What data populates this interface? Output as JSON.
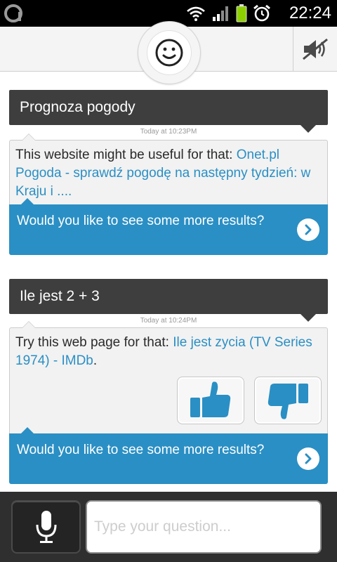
{
  "status_bar": {
    "time": "22:24",
    "icons": [
      "app-logo-icon",
      "wifi-icon",
      "signal-icon",
      "battery-icon",
      "alarm-icon"
    ]
  },
  "top_bar": {
    "avatar_icon": "smiley-face-icon",
    "mute_icon": "speaker-muted-icon"
  },
  "conversation": [
    {
      "query": "Prognoza pogody",
      "timestamp": "Today at 10:23PM",
      "answer_prefix": "This website might be useful for that: ",
      "answer_link": "Onet.pl Pogoda - sprawdź pogodę na następny tydzień: w Kraju i ....",
      "more_results": "Would you like to see some more results?"
    },
    {
      "query": "Ile jest 2 + 3",
      "timestamp": "Today at 10:24PM",
      "answer_prefix": "Try this web page for that: ",
      "answer_link": "Ile jest zycia (TV Series 1974) - IMDb",
      "answer_suffix": ".",
      "feedback_icons": [
        "thumbs-up-icon",
        "thumbs-down-icon"
      ],
      "more_results": "Would you like to see some more results?"
    }
  ],
  "input_bar": {
    "mic_icon": "microphone-icon",
    "placeholder": "Type your question..."
  },
  "colors": {
    "accent": "#2a8fc4",
    "query_bubble": "#3e3e3e",
    "answer_bubble": "#f2f2f2",
    "bottom_bar": "#2f2f2f"
  }
}
